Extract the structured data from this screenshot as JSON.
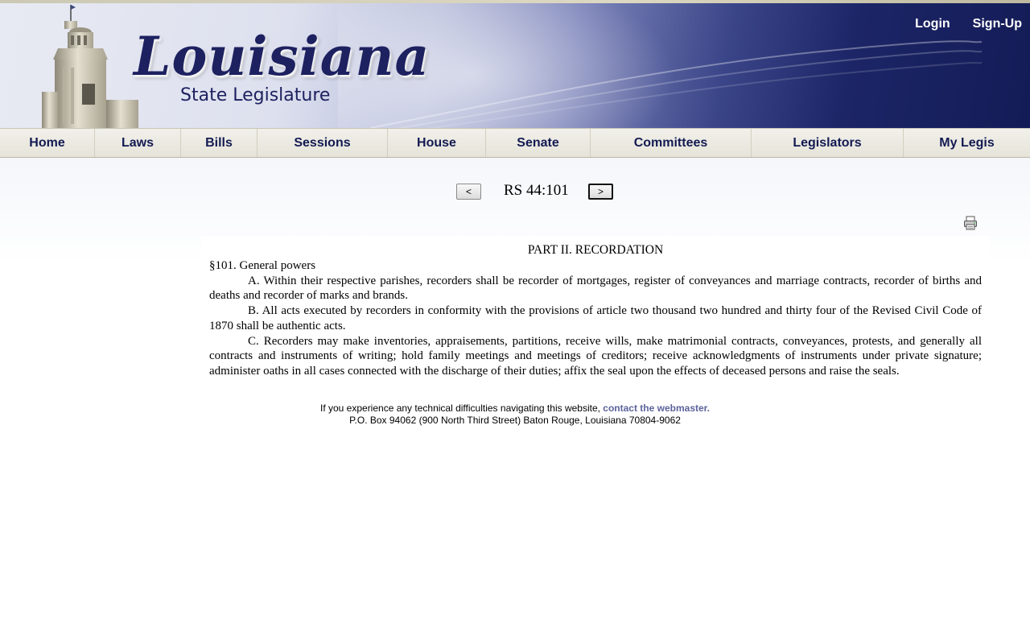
{
  "header": {
    "logo_word": "Louisiana",
    "logo_subtitle": "State Legislature",
    "login_label": "Login",
    "signup_label": "Sign-Up"
  },
  "nav": {
    "items": [
      {
        "label": "Home"
      },
      {
        "label": "Laws"
      },
      {
        "label": "Bills"
      },
      {
        "label": "Sessions"
      },
      {
        "label": "House"
      },
      {
        "label": "Senate"
      },
      {
        "label": "Committees"
      },
      {
        "label": "Legislators"
      },
      {
        "label": "My Legis"
      }
    ]
  },
  "doc_nav": {
    "prev_label": "<",
    "next_label": ">",
    "citation": "RS 44:101"
  },
  "document": {
    "part_heading": "PART II.  RECORDATION",
    "section_heading": "§101.  General powers",
    "paragraphs": [
      "A.  Within their respective parishes, recorders shall be recorder of mortgages, register of conveyances and marriage contracts, recorder of births and deaths and recorder of marks and brands.",
      "B.  All acts executed by recorders in conformity with the provisions of article two thousand two hundred and thirty four of the Revised Civil Code of 1870 shall be authentic acts.",
      "C.  Recorders may make inventories, appraisements, partitions, receive wills, make matrimonial contracts, conveyances, protests, and generally all contracts and instruments of writing; hold family meetings and meetings of creditors; receive acknowledgments of instruments under private signature; administer oaths in all cases connected with the discharge of their duties; affix the seal upon the effects of deceased persons and raise the seals."
    ]
  },
  "footer": {
    "notice": "If you experience any technical difficulties navigating this website, ",
    "link_text": "contact the webmaster.",
    "address": "P.O. Box 94062 (900 North Third Street) Baton Rouge, Louisiana 70804-9062"
  },
  "colors": {
    "nav_text": "#131a52",
    "banner_dark": "#141c57",
    "link": "#5c639a"
  },
  "icons": {
    "print": "printer-icon"
  }
}
